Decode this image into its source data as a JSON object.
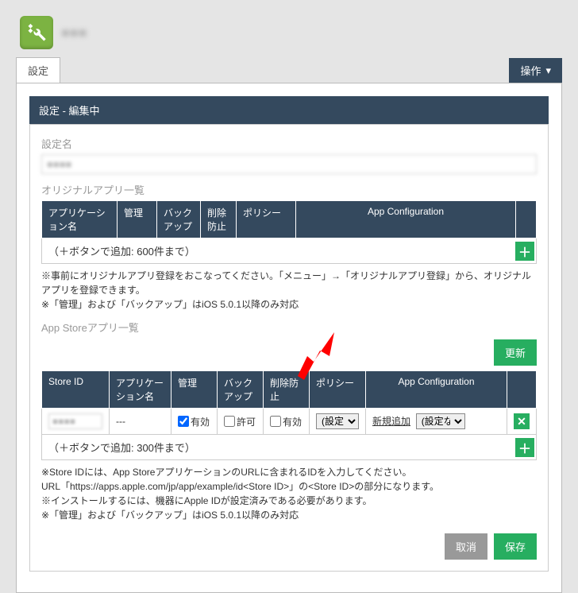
{
  "header": {
    "title": "■■■"
  },
  "tabs": {
    "settings": "設定"
  },
  "action_menu": "操作",
  "section": {
    "edit_header": "設定 - 編集中"
  },
  "field": {
    "setting_name_label": "設定名",
    "setting_name_value": "■■■■"
  },
  "original_apps": {
    "label": "オリジナルアプリ一覧",
    "headers": {
      "app_name": "アプリケーション名",
      "manage": "管理",
      "backup": "バックアップ",
      "delete_prevent": "削除防止",
      "policy": "ポリシー",
      "app_config": "App Configuration"
    },
    "add_text": "（＋ボタンで追加: 600件まで）",
    "note": "※事前にオリジナルアプリ登録をおこなってください。「メニュー」→「オリジナルアプリ登録」から、オリジナルアプリを登録できます。\n※「管理」および「バックアップ」はiOS 5.0.1以降のみ対応"
  },
  "appstore_apps": {
    "label": "App Storeアプリ一覧",
    "update_btn": "更新",
    "headers": {
      "store_id": "Store ID",
      "app_name": "アプリケーション名",
      "manage": "管理",
      "backup": "バックアップ",
      "delete_prevent": "削除防止",
      "policy": "ポリシー",
      "app_config": "App Configuration"
    },
    "row": {
      "store_id": "■■■■",
      "app_name": "---",
      "manage_checked": true,
      "manage_label": "有効",
      "backup_checked": false,
      "backup_label": "許可",
      "delete_checked": false,
      "delete_label": "有効",
      "policy_value": "(設定",
      "new_add": "新規追加",
      "config_value": "(設定な"
    },
    "add_text": "（＋ボタンで追加: 300件まで）",
    "note": "※Store IDには、App StoreアプリケーションのURLに含まれるIDを入力してください。\nURL「https://apps.apple.com/jp/app/example/id<Store ID>」の<Store ID>の部分になります。\n※インストールするには、機器にApple IDが設定済みである必要があります。\n※「管理」および「バックアップ」はiOS 5.0.1以降のみ対応"
  },
  "buttons": {
    "cancel": "取消",
    "save": "保存"
  }
}
